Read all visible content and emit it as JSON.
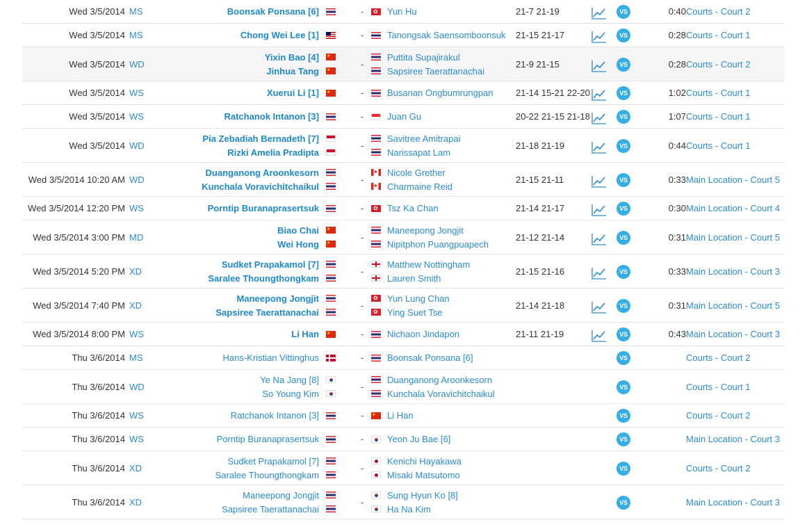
{
  "colors": {
    "link": "#2b8ccd",
    "vs_badge": "#35ade6",
    "row_alt": "#f5f5f5",
    "divider": "#e3e3e3"
  },
  "vs_label": "VS",
  "matches": [
    {
      "date": "Wed 3/5/2014",
      "event": "MS",
      "winner_side": true,
      "alt": false,
      "team1": [
        {
          "name": "Boonsak Ponsana [6]",
          "flag": "THA"
        }
      ],
      "team2": [
        {
          "name": "Yun Hu",
          "flag": "HKG"
        }
      ],
      "score": "21-7 21-19",
      "duration": "0:40",
      "court": "Courts - Court 2",
      "stats": true
    },
    {
      "date": "Wed 3/5/2014",
      "event": "MS",
      "winner_side": true,
      "alt": false,
      "team1": [
        {
          "name": "Chong Wei Lee [1]",
          "flag": "MAS"
        }
      ],
      "team2": [
        {
          "name": "Tanongsak Saensomboonsuk",
          "flag": "THA"
        }
      ],
      "score": "21-15 21-17",
      "duration": "0:28",
      "court": "Courts - Court 1",
      "stats": true
    },
    {
      "date": "Wed 3/5/2014",
      "event": "WD",
      "winner_side": true,
      "alt": true,
      "team1": [
        {
          "name": "Yixin Bao [4]",
          "flag": "CHN"
        },
        {
          "name": "Jinhua Tang",
          "flag": "CHN"
        }
      ],
      "team2": [
        {
          "name": "Puttita Supajirakul",
          "flag": "THA"
        },
        {
          "name": "Sapsiree Taerattanachai",
          "flag": "THA"
        }
      ],
      "score": "21-9 21-15",
      "duration": "0:28",
      "court": "Courts - Court 2",
      "stats": true
    },
    {
      "date": "Wed 3/5/2014",
      "event": "WS",
      "winner_side": true,
      "alt": false,
      "team1": [
        {
          "name": "Xuerui Li [1]",
          "flag": "CHN"
        }
      ],
      "team2": [
        {
          "name": "Busanan Ongbumrungpan",
          "flag": "THA"
        }
      ],
      "score": "21-14 15-21 22-20",
      "duration": "1:02",
      "court": "Courts - Court 1",
      "stats": true
    },
    {
      "date": "Wed 3/5/2014",
      "event": "WS",
      "winner_side": true,
      "alt": false,
      "team1": [
        {
          "name": "Ratchanok Intanon [3]",
          "flag": "THA"
        }
      ],
      "team2": [
        {
          "name": "Juan Gu",
          "flag": "SIN"
        }
      ],
      "score": "20-22 21-15 21-18",
      "duration": "1:07",
      "court": "Courts - Court 1",
      "stats": true
    },
    {
      "date": "Wed 3/5/2014",
      "event": "WD",
      "winner_side": true,
      "alt": false,
      "team1": [
        {
          "name": "Pia Zebadiah Bernadeth [7]",
          "flag": "INA"
        },
        {
          "name": "Rizki Amelia Pradipta",
          "flag": "INA"
        }
      ],
      "team2": [
        {
          "name": "Savitree Amitrapai",
          "flag": "THA"
        },
        {
          "name": "Narissapat Lam",
          "flag": "THA"
        }
      ],
      "score": "21-18 21-19",
      "duration": "0:44",
      "court": "Courts - Court 1",
      "stats": true
    },
    {
      "date": "Wed 3/5/2014 10:20 AM",
      "event": "WD",
      "winner_side": true,
      "alt": false,
      "team1": [
        {
          "name": "Duanganong Aroonkesorn",
          "flag": "THA"
        },
        {
          "name": "Kunchala Voravichitchaikul",
          "flag": "THA"
        }
      ],
      "team2": [
        {
          "name": "Nicole Grether",
          "flag": "CAN"
        },
        {
          "name": "Charmaine Reid",
          "flag": "CAN"
        }
      ],
      "score": "21-15 21-11",
      "duration": "0:33",
      "court": "Main Location - Court 5",
      "stats": true
    },
    {
      "date": "Wed 3/5/2014 12:20 PM",
      "event": "WS",
      "winner_side": true,
      "alt": false,
      "team1": [
        {
          "name": "Porntip Buranaprasertsuk",
          "flag": "THA"
        }
      ],
      "team2": [
        {
          "name": "Tsz Ka Chan",
          "flag": "HKG"
        }
      ],
      "score": "21-14 21-17",
      "duration": "0:30",
      "court": "Main Location - Court 4",
      "stats": true
    },
    {
      "date": "Wed 3/5/2014 3:00 PM",
      "event": "MD",
      "winner_side": true,
      "alt": false,
      "team1": [
        {
          "name": "Biao Chai",
          "flag": "CHN"
        },
        {
          "name": "Wei Hong",
          "flag": "CHN"
        }
      ],
      "team2": [
        {
          "name": "Maneepong Jongjit",
          "flag": "THA"
        },
        {
          "name": "Nipitphon Puangpuapech",
          "flag": "THA"
        }
      ],
      "score": "21-12 21-14",
      "duration": "0:31",
      "court": "Main Location - Court 5",
      "stats": true
    },
    {
      "date": "Wed 3/5/2014 5:20 PM",
      "event": "XD",
      "winner_side": true,
      "alt": false,
      "team1": [
        {
          "name": "Sudket Prapakamol [7]",
          "flag": "THA"
        },
        {
          "name": "Saralee Thoungthongkam",
          "flag": "THA"
        }
      ],
      "team2": [
        {
          "name": "Matthew Nottingham",
          "flag": "ENG"
        },
        {
          "name": "Lauren Smith",
          "flag": "ENG"
        }
      ],
      "score": "21-15 21-16",
      "duration": "0:33",
      "court": "Main Location - Court 3",
      "stats": true
    },
    {
      "date": "Wed 3/5/2014 7:40 PM",
      "event": "XD",
      "winner_side": true,
      "alt": false,
      "team1": [
        {
          "name": "Maneepong Jongjit",
          "flag": "THA"
        },
        {
          "name": "Sapsiree Taerattanachai",
          "flag": "THA"
        }
      ],
      "team2": [
        {
          "name": "Yun Lung Chan",
          "flag": "HKG"
        },
        {
          "name": "Ying Suet Tse",
          "flag": "HKG"
        }
      ],
      "score": "21-14 21-18",
      "duration": "0:31",
      "court": "Main Location - Court 5",
      "stats": true
    },
    {
      "date": "Wed 3/5/2014 8:00 PM",
      "event": "WS",
      "winner_side": true,
      "alt": false,
      "team1": [
        {
          "name": "Li Han",
          "flag": "CHN"
        }
      ],
      "team2": [
        {
          "name": "Nichaon Jindapon",
          "flag": "THA"
        }
      ],
      "score": "21-11 21-19",
      "duration": "0:43",
      "court": "Main Location - Court 3",
      "stats": true
    },
    {
      "date": "Thu 3/6/2014",
      "event": "MS",
      "winner_side": false,
      "alt": false,
      "team1": [
        {
          "name": "Hans-Kristian Vittinghus",
          "flag": "DEN"
        }
      ],
      "team2": [
        {
          "name": "Boonsak Ponsana [6]",
          "flag": "THA"
        }
      ],
      "score": "",
      "duration": "",
      "court": "Courts - Court 2",
      "stats": false
    },
    {
      "date": "Thu 3/6/2014",
      "event": "WD",
      "winner_side": false,
      "alt": false,
      "team1": [
        {
          "name": "Ye Na Jang [8]",
          "flag": "KOR"
        },
        {
          "name": "So Young Kim",
          "flag": "KOR"
        }
      ],
      "team2": [
        {
          "name": "Duanganong Aroonkesorn",
          "flag": "THA"
        },
        {
          "name": "Kunchala Voravichitchaikul",
          "flag": "THA"
        }
      ],
      "score": "",
      "duration": "",
      "court": "Courts - Court 1",
      "stats": false
    },
    {
      "date": "Thu 3/6/2014",
      "event": "WS",
      "winner_side": false,
      "alt": false,
      "team1": [
        {
          "name": "Ratchanok Intanon [3]",
          "flag": "THA"
        }
      ],
      "team2": [
        {
          "name": "Li Han",
          "flag": "CHN"
        }
      ],
      "score": "",
      "duration": "",
      "court": "Courts - Court 2",
      "stats": false
    },
    {
      "date": "Thu 3/6/2014",
      "event": "WS",
      "winner_side": false,
      "alt": false,
      "team1": [
        {
          "name": "Porntip Buranaprasertsuk",
          "flag": "THA"
        }
      ],
      "team2": [
        {
          "name": "Yeon Ju Bae [6]",
          "flag": "KOR"
        }
      ],
      "score": "",
      "duration": "",
      "court": "Main Location - Court 3",
      "stats": false
    },
    {
      "date": "Thu 3/6/2014",
      "event": "XD",
      "winner_side": false,
      "alt": false,
      "team1": [
        {
          "name": "Sudket Prapakamol [7]",
          "flag": "THA"
        },
        {
          "name": "Saralee Thoungthongkam",
          "flag": "THA"
        }
      ],
      "team2": [
        {
          "name": "Kenichi Hayakawa",
          "flag": "JPN"
        },
        {
          "name": "Misaki Matsutomo",
          "flag": "JPN"
        }
      ],
      "score": "",
      "duration": "",
      "court": "Courts - Court 2",
      "stats": false
    },
    {
      "date": "Thu 3/6/2014",
      "event": "XD",
      "winner_side": false,
      "alt": false,
      "team1": [
        {
          "name": "Maneepong Jongjit",
          "flag": "THA"
        },
        {
          "name": "Sapsiree Taerattanachai",
          "flag": "THA"
        }
      ],
      "team2": [
        {
          "name": "Sung Hyun Ko [8]",
          "flag": "KOR"
        },
        {
          "name": "Ha Na Kim",
          "flag": "KOR"
        }
      ],
      "score": "",
      "duration": "",
      "court": "Main Location - Court 3",
      "stats": false
    }
  ]
}
